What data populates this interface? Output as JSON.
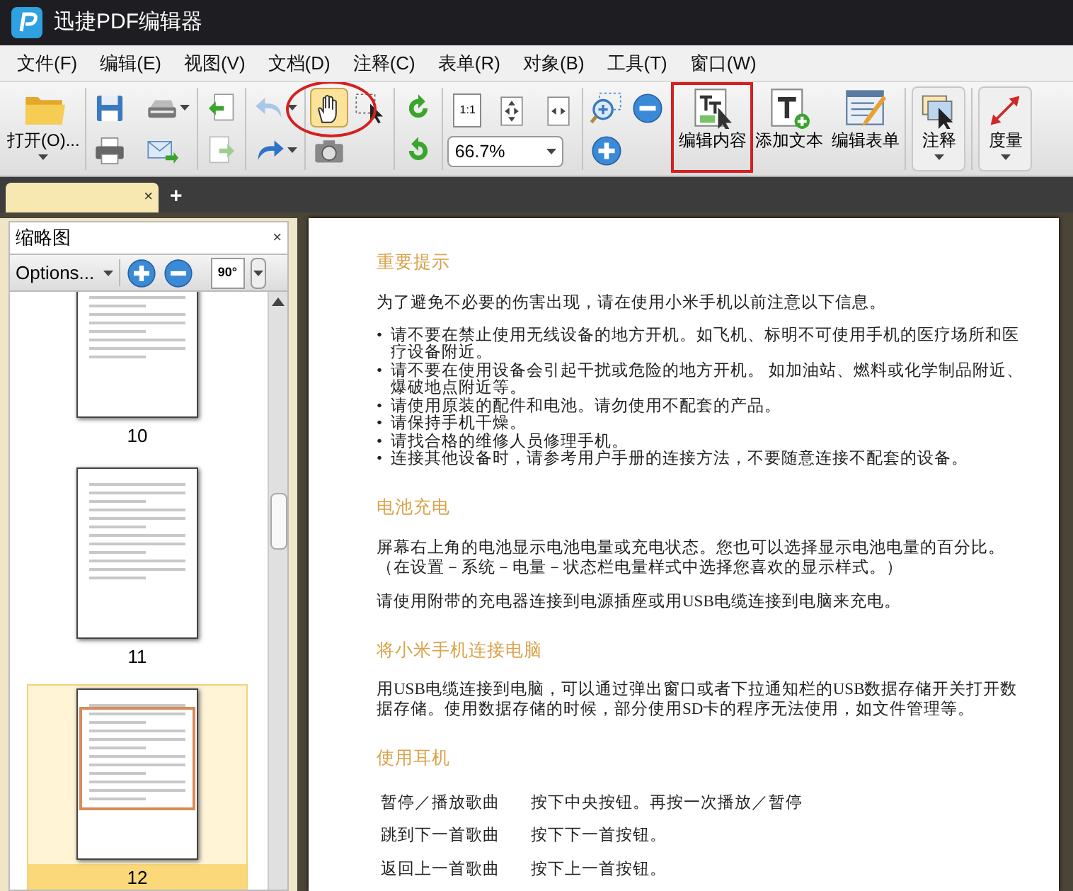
{
  "window": {
    "title": "迅捷PDF编辑器"
  },
  "menu": [
    "文件(F)",
    "编辑(E)",
    "视图(V)",
    "文档(D)",
    "注释(C)",
    "表单(R)",
    "对象(B)",
    "工具(T)",
    "窗口(W)"
  ],
  "toolbar": [
    {
      "kind": "big",
      "buttons": [
        {
          "label": "打开(O)...",
          "dropdown": true
        }
      ]
    },
    {
      "kind": "grid",
      "buttons": [
        {
          "dropdown": false
        },
        {
          "dropdown": true
        },
        {
          "dropdown": false
        },
        {
          "dropdown": false
        }
      ]
    },
    {
      "kind": "grid",
      "buttons": [
        {
          "dropdown": false
        },
        {
          "dropdown": false
        }
      ]
    },
    {
      "kind": "grid",
      "buttons": [
        {
          "dropdown": true
        },
        {
          "dropdown": true
        }
      ]
    },
    {
      "kind": "modes",
      "buttons": [
        {
          "selected": true
        },
        {
          "selected": false
        },
        {
          "selected": false
        }
      ]
    },
    {
      "kind": "grid",
      "buttons": [
        {
          "dropdown": false
        },
        {
          "dropdown": false
        }
      ]
    },
    {
      "kind": "zoom",
      "buttons": [
        {
          "text": "1:1"
        },
        {
          "dropdown": false
        },
        {
          "dropdown": false
        }
      ],
      "zoom_value": "66.7%"
    },
    {
      "kind": "grid",
      "buttons": [
        {
          "dropdown": false
        },
        {
          "dropdown": false
        },
        {
          "dropdown": false
        }
      ]
    },
    {
      "kind": "big",
      "buttons": [
        {
          "label": "编辑内容",
          "dropdown": false
        },
        {
          "label": "添加文本",
          "dropdown": false
        },
        {
          "label": "编辑表单",
          "dropdown": false
        }
      ]
    },
    {
      "kind": "big",
      "buttons": [
        {
          "label": "注释",
          "dropdown": true
        }
      ]
    },
    {
      "kind": "big",
      "buttons": [
        {
          "label": "度量",
          "dropdown": true
        }
      ]
    }
  ],
  "tabs": [
    {
      "close": "×",
      "selected": true
    }
  ],
  "new_tab": "+",
  "thumbnail_panel": {
    "title": "缩略图",
    "close": "×",
    "options": "Options...",
    "rotate": "90°",
    "pages": [
      {
        "label": "10",
        "selected": false
      },
      {
        "label": "11",
        "selected": false
      },
      {
        "label": "12",
        "selected": true
      }
    ]
  },
  "document": {
    "sections": [
      {
        "heading": "重要提示",
        "blocks": [
          {
            "kind": "paragraph",
            "text": "为了避免不必要的伤害出现，请在使用小米手机以前注意以下信息。"
          },
          {
            "kind": "bullets",
            "bullet": "•",
            "items": [
              "请不要在禁止使用无线设备的地方开机。如飞机、标明不可使用手机的医疗场所和医疗设备附近。",
              "请不要在使用设备会引起干扰或危险的地方开机。 如加油站、燃料或化学制品附近、爆破地点附近等。",
              "请使用原装的配件和电池。请勿使用不配套的产品。",
              "请保持手机干燥。",
              "请找合格的维修人员修理手机。",
              "连接其他设备时，请参考用户手册的连接方法，不要随意连接不配套的设备。"
            ]
          }
        ]
      },
      {
        "heading": "电池充电",
        "blocks": [
          {
            "kind": "paragraph",
            "text": "屏幕右上角的电池显示电池电量或充电状态。您也可以选择显示电池电量的百分比。（在设置－系统－电量－状态栏电量样式中选择您喜欢的显示样式。）"
          },
          {
            "kind": "paragraph",
            "text": "请使用附带的充电器连接到电源插座或用USB电缆连接到电脑来充电。"
          }
        ]
      },
      {
        "heading": "将小米手机连接电脑",
        "blocks": [
          {
            "kind": "paragraph",
            "text": "用USB电缆连接到电脑，可以通过弹出窗口或者下拉通知栏的USB数据存储开关打开数据存储。使用数据存储的时候，部分使用SD卡的程序无法使用，如文件管理等。"
          }
        ]
      },
      {
        "heading": "使用耳机",
        "blocks": [
          {
            "kind": "table",
            "rows": [
              [
                "暂停／播放歌曲",
                "按下中央按钮。再按一次播放／暂停"
              ],
              [
                "跳到下一首歌曲",
                "按下下一首按钮。"
              ],
              [
                "返回上一首歌曲",
                "按下上一首按钮。"
              ]
            ]
          }
        ]
      }
    ]
  }
}
